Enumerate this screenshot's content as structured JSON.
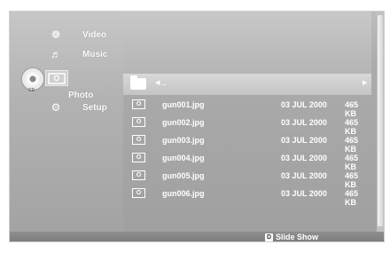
{
  "menu": {
    "items": [
      {
        "label": "Video",
        "icon": "film-reel-icon"
      },
      {
        "label": "Music",
        "icon": "music-note-icon"
      },
      {
        "label": "Photo",
        "icon": "photo-icon",
        "selected": true
      },
      {
        "label": "Setup",
        "icon": "gear-icon"
      }
    ],
    "disc_label": "CD"
  },
  "browser": {
    "parent_label": ".."
  },
  "files": [
    {
      "name": "gun001.jpg",
      "date": "03 JUL 2000",
      "size": "465 KB"
    },
    {
      "name": "gun002.jpg",
      "date": "03 JUL 2000",
      "size": "465 KB"
    },
    {
      "name": "gun003.jpg",
      "date": "03 JUL 2000",
      "size": "465 KB"
    },
    {
      "name": "gun004.jpg",
      "date": "03 JUL 2000",
      "size": "465 KB"
    },
    {
      "name": "gun005.jpg",
      "date": "03 JUL 2000",
      "size": "465 KB"
    },
    {
      "name": "gun006.jpg",
      "date": "03 JUL 2000",
      "size": "465 KB"
    }
  ],
  "footer": {
    "button_key": "D",
    "action_label": "Slide Show"
  }
}
